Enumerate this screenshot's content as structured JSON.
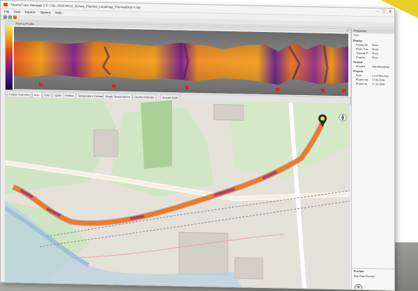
{
  "window": {
    "title": "ThermoTrace Manager 2.0 - File: 2016-09-11_Survey_Pipeline_Localmap_ThermalStrip-1.dat",
    "controls": [
      "–",
      "□",
      "✕"
    ]
  },
  "menu": [
    "File",
    "View",
    "Reports",
    "Options",
    "Help"
  ],
  "thermal_panel": {
    "title": "Thermal Profile",
    "close": "×"
  },
  "tabs": [
    "Project Overview",
    "Map",
    "Grid",
    "Spiral",
    "Profiles",
    "Temperature Domain",
    "Single Temperatures",
    "Quality Indicator",
    "Screed Width"
  ],
  "active_tab": "Map",
  "properties": {
    "title": "Properties",
    "subtitle": "Map",
    "sections": [
      {
        "name": "Display",
        "rows": [
          {
            "key": "Paving Dir.",
            "value": "Show"
          },
          {
            "key": "Paver Trac",
            "value": "Show"
          },
          {
            "key": "Thermal Pr",
            "value": "Show"
          },
          {
            "key": "Projects",
            "value": "Show"
          }
        ]
      },
      {
        "name": "General",
        "rows": [
          {
            "key": "Provider",
            "value": "OpenStreetMap"
          }
        ]
      },
      {
        "name": "Projects",
        "rows": [
          {
            "key": "Root",
            "value": "Local Directory"
          },
          {
            "key": "Project sta",
            "value": "17.09.2016"
          },
          {
            "key": "Project en",
            "value": "17.10.2016"
          }
        ]
      }
    ],
    "footer_title": "Provider",
    "footer_text": "Map Data Provider"
  },
  "colors": {
    "thermal_hot": "#f39a1d",
    "thermal_cold": "#7a2a9a",
    "track": "#f07a24",
    "accent_yellow": "#e8cf2a"
  },
  "icons": {
    "location_marker": "map-pin-icon",
    "navigation": "compass-icon"
  }
}
